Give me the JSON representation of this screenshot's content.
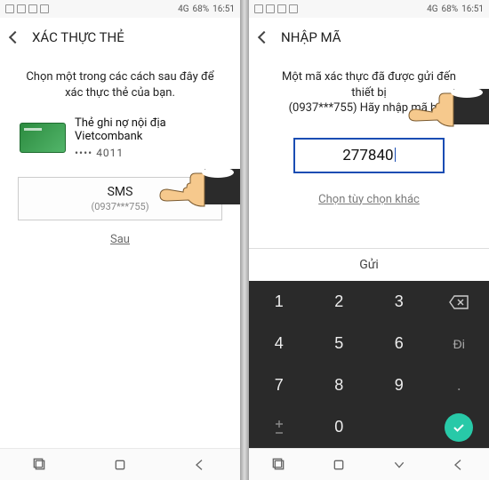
{
  "status": {
    "battery_pct": "68%",
    "time": "16:51",
    "net": "4G"
  },
  "left": {
    "title": "XÁC THỰC THẺ",
    "instruction": "Chọn một trong các cách sau đây để xác thực thẻ của bạn.",
    "card": {
      "name": "Thẻ ghi nợ nội địa",
      "bank": "Vietcombank",
      "last4_prefix": "••••",
      "last4": "4011"
    },
    "sms_button": {
      "label": "SMS",
      "phone": "(0937***755)"
    },
    "later": "Sau"
  },
  "right": {
    "title": "NHẬP MÃ",
    "instruction_line1": "Một mã xác thực đã được gửi đến thiết bị",
    "instruction_line2": "(0937***755) Hãy nhập mã bên",
    "code": "277840",
    "other_option": "Chọn tùy chọn khác",
    "send": "Gửi",
    "keypad": [
      "1",
      "2",
      "3",
      "⌫",
      "4",
      "5",
      "6",
      "↵",
      "7",
      "8",
      "9",
      ".",
      "±",
      "0",
      "",
      ""
    ]
  }
}
